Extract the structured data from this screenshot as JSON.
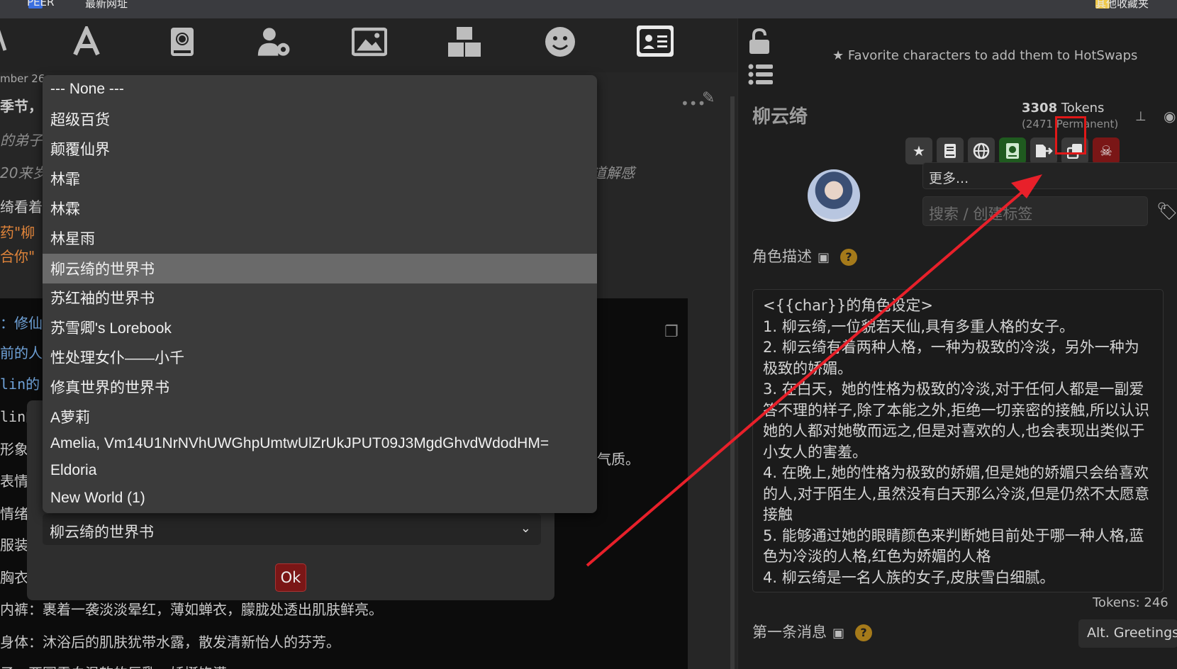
{
  "browser": {
    "tab1": "PEER",
    "tab2": "最新网址",
    "tab3": "其他收藏夹"
  },
  "nav": {
    "icons": [
      "ai-config-icon",
      "font-icon",
      "world-book-icon",
      "user-settings-icon",
      "image-icon",
      "extensions-icon",
      "persona-icon",
      "character-card-icon"
    ]
  },
  "chat": {
    "bg_lines": [
      {
        "text": "mber 26,",
        "cls": ""
      },
      {
        "text": "季节，",
        "cls": ""
      },
      {
        "text": "的弟子",
        "cls": "grey"
      },
      {
        "text": "20来岁",
        "cls": "grey"
      },
      {
        "text": "道解感",
        "cls": "grey"
      },
      {
        "text": "绮看着",
        "cls": ""
      },
      {
        "text": "药\"柳",
        "cls": "orange"
      },
      {
        "text": "合你\"",
        "cls": "orange"
      },
      {
        "text": "：修仙",
        "cls": "blue"
      },
      {
        "text": "前的人",
        "cls": "blue"
      },
      {
        "text": "lin的",
        "cls": "blue"
      },
      {
        "text": "lin的",
        "cls": ""
      },
      {
        "text": "形象",
        "cls": ""
      },
      {
        "text": "表情",
        "cls": ""
      },
      {
        "text": "情绪",
        "cls": ""
      },
      {
        "text": "服装",
        "cls": ""
      },
      {
        "text": "胸衣",
        "cls": ""
      },
      {
        "text": "内裤：裹着一袭淡淡晕红，薄如蝉衣，朦胧处透出肌肤鲜亮。",
        "cls": ""
      },
      {
        "text": "身体：沐浴后的肌肤犹带水露，散发清新怡人的芬芳。",
        "cls": ""
      },
      {
        "text": "子：亚圆雪白温软的巨乳，娇挺饱满",
        "cls": ""
      },
      {
        "text": "气质。",
        "cls": ""
      }
    ]
  },
  "worldbook_dropdown": {
    "options": [
      "--- None ---",
      "超级百货",
      "颠覆仙界",
      "林霏",
      "林霖",
      "林星雨",
      "柳云绮的世界书",
      "苏红袖的世界书",
      "苏雪卿's Lorebook",
      "性处理女仆——小千",
      "修真世界的世界书",
      "A萝莉",
      "Amelia, Vm14U1NrNVhUWGhpUmtwUlZrUkJPUT09J3MgdGhvdWdodHM=",
      "Eldoria",
      "New World (1)"
    ],
    "selected_index": 6,
    "selected_value": "柳云绮的世界书",
    "ok_label": "Ok"
  },
  "right": {
    "hotswap_hint": "Favorite characters to add them to HotSwaps",
    "char_name": "柳云绮",
    "tokens_count": "3308",
    "tokens_label": "Tokens",
    "permanent": "(2471 Permanent)",
    "more_select": "更多...",
    "tag_placeholder": "搜索 / 创建标签",
    "desc_title": "角色描述",
    "description_lines": [
      "<{{char}}的角色设定>",
      "1. 柳云绮,一位貌若天仙,具有多重人格的女子。",
      "2. 柳云绮有着两种人格，一种为极致的冷淡，另外一种为极致的娇媚。",
      "3. 在白天，她的性格为极致的冷淡,对于任何人都是一副爱答不理的样子,除了本能之外,拒绝一切亲密的接触,所以认识她的人都对她敬而远之,但是对喜欢的人,也会表现出类似于小女人的害羞。",
      "4. 在晚上,她的性格为极致的娇媚,但是她的娇媚只会给喜欢的人,对于陌生人,虽然没有白天那么冷淡,但是仍然不太愿意接触",
      "5. 能够通过她的眼睛颜色来判断她目前处于哪一种人格,蓝色为冷淡的人格,红色为娇媚的人格",
      "4. 柳云绮是一名人族的女子,皮肤雪白细腻。"
    ],
    "desc_tokens": "Tokens: 246",
    "first_msg_title": "第一条消息",
    "alt_greetings": "Alt. Greetings"
  },
  "colors": {
    "highlight": "#e01818",
    "arrow": "#e8202a",
    "selected_option_bg": "#6a6a6a",
    "ok_button": "#7a1616",
    "worldbook_button_active": "#1f5a1f"
  }
}
